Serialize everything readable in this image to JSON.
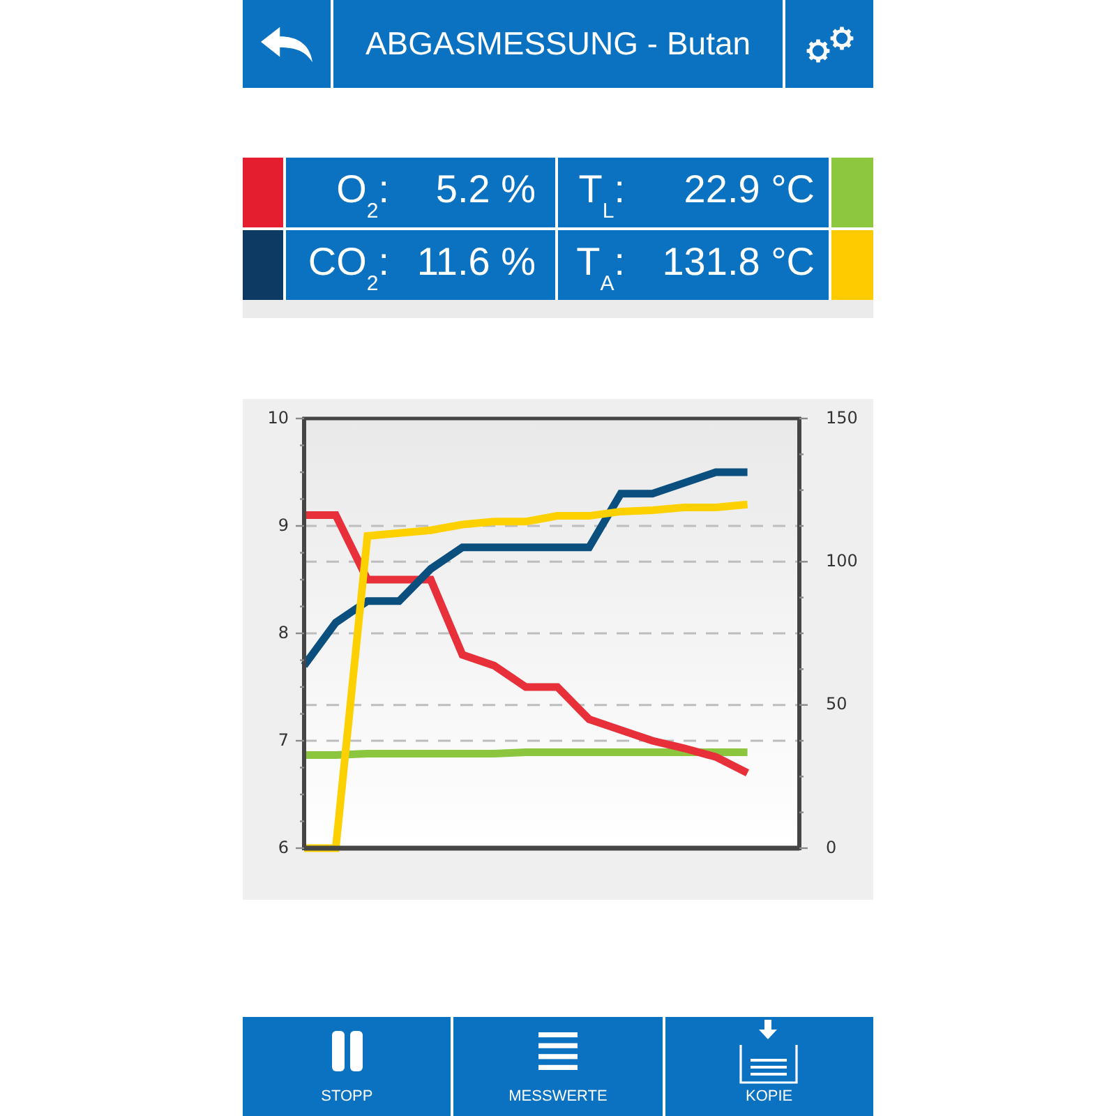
{
  "header": {
    "title": "ABGASMESSUNG - Butan"
  },
  "measurements": {
    "rows": [
      {
        "cells": [
          {
            "label": "O$_{2}$:",
            "value": "5.2 %",
            "color": "#e41e2f"
          },
          {
            "label": "T$_{L}$:",
            "value": "22.9 °C",
            "color": "#8dc63f"
          }
        ]
      },
      {
        "cells": [
          {
            "label": "CO$_{2}$:",
            "value": "11.6 %",
            "color": "#0d3a63"
          },
          {
            "label": "T$_{A}$:",
            "value": "131.8 °C",
            "color": "#fdcb00"
          }
        ]
      }
    ]
  },
  "chart": {
    "chart_data": {
      "type": "line",
      "grid": true,
      "ylim": [
        6,
        10
      ],
      "yticks": [
        6,
        7,
        8,
        9,
        10
      ],
      "y2lim": [
        0,
        150
      ],
      "y2ticks": [
        0,
        50,
        100,
        150
      ],
      "series": [
        {
          "color": "#8cc63f",
          "axis": "y2",
          "values": [
            32.5,
            32.5,
            33,
            33,
            33,
            33,
            33,
            33.5,
            33.5,
            33.5,
            33.5,
            33.5,
            33.5,
            33.5,
            33.5
          ]
        },
        {
          "color": "#e8303a",
          "values": [
            9.1,
            9.1,
            8.5,
            8.5,
            8.5,
            7.8,
            7.7,
            7.5,
            7.5,
            7.2,
            7.1,
            7.0,
            6.93,
            6.85,
            6.7
          ]
        },
        {
          "color": "#0a4f7e",
          "values": [
            7.7,
            8.1,
            8.3,
            8.3,
            8.6,
            8.8,
            8.8,
            8.8,
            8.8,
            8.8,
            9.3,
            9.3,
            9.4,
            9.5,
            9.5
          ]
        },
        {
          "color": "#fdd100",
          "axis": "y2",
          "values": [
            0,
            0,
            109,
            110,
            111,
            113,
            114,
            114,
            116,
            116,
            117.5,
            118,
            119,
            119,
            120
          ]
        }
      ]
    }
  },
  "toolbar": {
    "buttons": [
      {
        "label": "STOPP",
        "kind": "pause"
      },
      {
        "label": "MESSWERTE",
        "kind": "list"
      },
      {
        "label": "KOPIE",
        "kind": "copy"
      }
    ]
  }
}
